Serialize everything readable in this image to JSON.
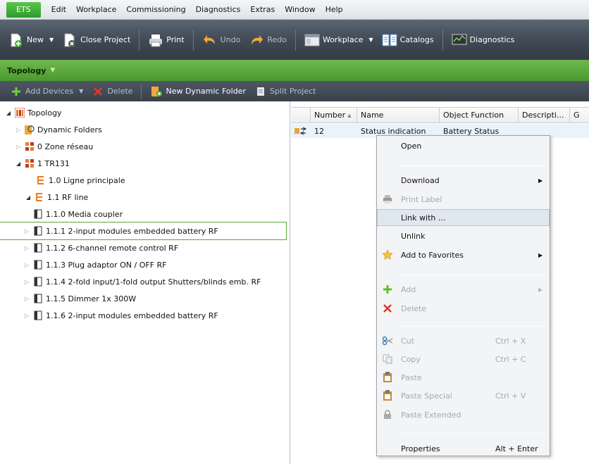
{
  "menubar": {
    "brand": "ETS",
    "items": [
      "Edit",
      "Workplace",
      "Commissioning",
      "Diagnostics",
      "Extras",
      "Window",
      "Help"
    ]
  },
  "toolbar": {
    "new_label": "New",
    "close_project_label": "Close Project",
    "print_label": "Print",
    "undo_label": "Undo",
    "redo_label": "Redo",
    "workplace_label": "Workplace",
    "catalogs_label": "Catalogs",
    "diagnostics_label": "Diagnostics"
  },
  "panel": {
    "title": "Topology"
  },
  "subbar": {
    "add_devices_label": "Add Devices",
    "delete_label": "Delete",
    "new_dynamic_folder_label": "New Dynamic Folder",
    "split_project_label": "Split Project"
  },
  "tree": {
    "items": [
      {
        "label": "Topology"
      },
      {
        "label": "Dynamic Folders"
      },
      {
        "label": "0 Zone réseau"
      },
      {
        "label": "1 TR131"
      },
      {
        "label": "1.0 Ligne principale"
      },
      {
        "label": "1.1 RF line"
      },
      {
        "label": "1.1.0  Media coupler"
      },
      {
        "label": "1.1.1  2-input modules embedded battery RF"
      },
      {
        "label": "1.1.2  6-channel remote control RF"
      },
      {
        "label": "1.1.3  Plug adaptor ON / OFF RF"
      },
      {
        "label": "1.1.4  2-fold input/1-fold output Shutters/blinds emb. RF"
      },
      {
        "label": "1.1.5  Dimmer 1x 300W"
      },
      {
        "label": "1.1.6  2-input modules embedded battery RF"
      }
    ]
  },
  "grid": {
    "columns": [
      "Number",
      "Name",
      "Object Function",
      "Descripti...",
      "G"
    ],
    "rows": [
      {
        "number": "12",
        "name": "Status indication",
        "object_function": "Battery Status"
      }
    ]
  },
  "context_menu": {
    "open": "Open",
    "download": "Download",
    "print_label": "Print Label",
    "link_with": "Link with ...",
    "unlink": "Unlink",
    "add_to_favorites": "Add to Favorites",
    "add": "Add",
    "delete": "Delete",
    "cut": "Cut",
    "cut_shortcut": "Ctrl + X",
    "copy": "Copy",
    "copy_shortcut": "Ctrl + C",
    "paste": "Paste",
    "paste_special": "Paste Special",
    "paste_special_shortcut": "Ctrl + V",
    "paste_extended": "Paste Extended",
    "properties": "Properties",
    "properties_shortcut": "Alt + Enter"
  },
  "colors": {
    "accent_green": "#4b9a2f",
    "toolbar_dark": "#3f4853",
    "selection_border": "#5aa73e",
    "menu_highlight": "#dfe8f0"
  }
}
